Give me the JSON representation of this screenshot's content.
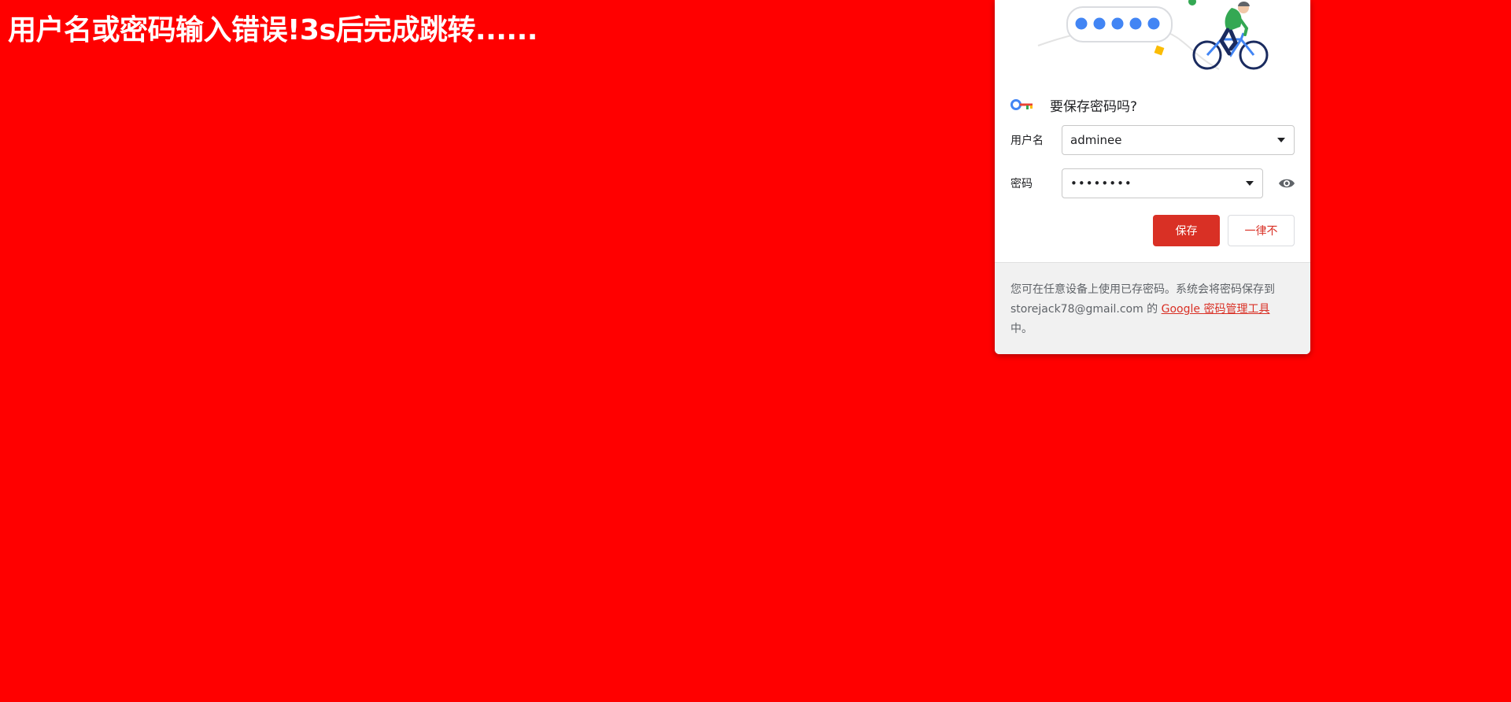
{
  "page": {
    "background_color": "#ff0000",
    "message": "用户名或密码输入错误!3s后完成跳转......"
  },
  "save_password_bubble": {
    "title": "要保存密码吗?",
    "username_label": "用户名",
    "username_value": "adminee",
    "password_label": "密码",
    "password_value": "••••••••",
    "save_button": "保存",
    "never_button": "一律不",
    "footer_text_before": "您可在任意设备上使用已存密码。系统会将密码保存到 storejack78@gmail.com 的 ",
    "footer_link": "Google 密码管理工具",
    "footer_text_after": "中。",
    "accent_color": "#d93025",
    "icons": {
      "key": "key-icon",
      "username_dropdown": "caret-down-icon",
      "password_dropdown": "caret-down-icon",
      "reveal_password": "eye-icon"
    }
  }
}
